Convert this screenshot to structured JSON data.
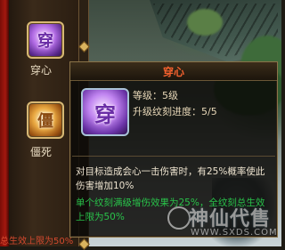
{
  "skills": [
    {
      "name": "穿心",
      "icon": "purple-rune-icon",
      "glyph": "穿"
    },
    {
      "name": "僵死",
      "icon": "gold-rune-icon",
      "glyph": "僵"
    }
  ],
  "tooltip": {
    "title": "穿心",
    "icon": "purple-rune-icon",
    "glyph": "穿",
    "level_text": "等级：5级",
    "progress_text": "升级纹刻进度：5/5",
    "description": "对目标造成会心一击伤害时，有25%概率使此伤害增加10%",
    "bonus": "单个纹刻满级增伤效果为25%，全纹刻总生效上限为50%"
  },
  "left_bottom_text": "总生效上限为50%",
  "watermark": {
    "name": "神仙代售",
    "url": "WWW.SXDS.COM"
  },
  "colors": {
    "title": "#f2602e",
    "bonus_text": "#29c24a",
    "panel_border": "#8a7348"
  }
}
